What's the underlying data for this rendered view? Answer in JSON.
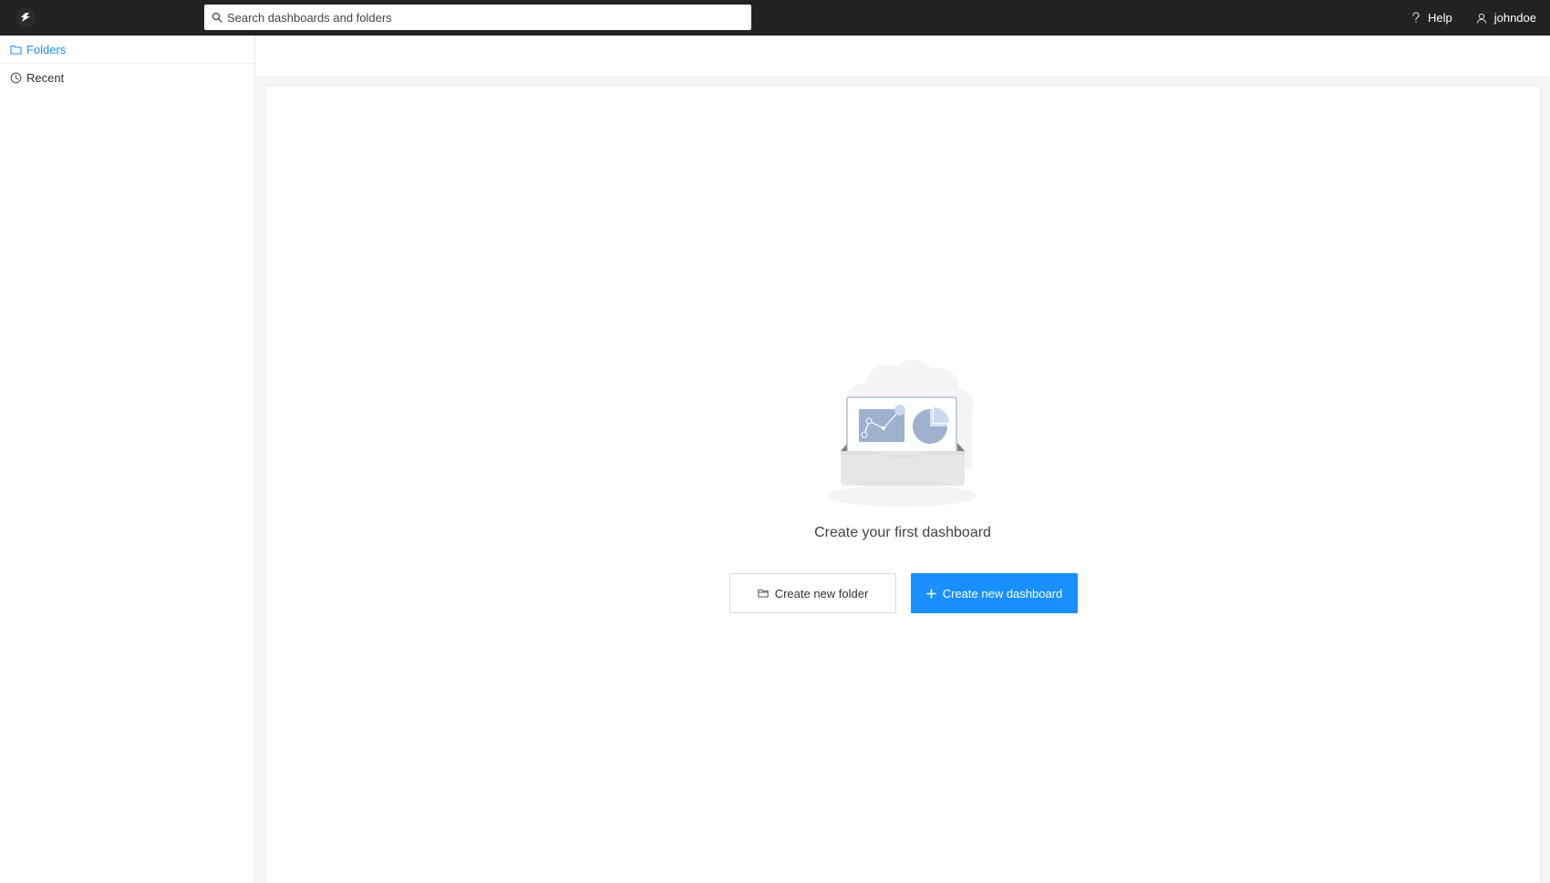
{
  "topbar": {
    "search_placeholder": "Search dashboards and folders",
    "help_label": "Help",
    "user_label": "johndoe",
    "background_color": "#222222"
  },
  "sidebar": {
    "items": [
      {
        "label": "Folders",
        "icon": "folder-icon",
        "active": true
      },
      {
        "label": "Recent",
        "icon": "clock-icon",
        "active": false
      }
    ]
  },
  "main": {
    "empty_state": {
      "title": "Create your first dashboard",
      "illustration": "empty-dashboard-illustration"
    },
    "buttons": {
      "create_folder_label": "Create new folder",
      "create_folder_icon": "folder-outline-icon",
      "create_dashboard_label": "Create new dashboard",
      "create_dashboard_icon": "plus-icon"
    }
  },
  "colors": {
    "accent": "#1890ff",
    "topbar": "#222222"
  }
}
